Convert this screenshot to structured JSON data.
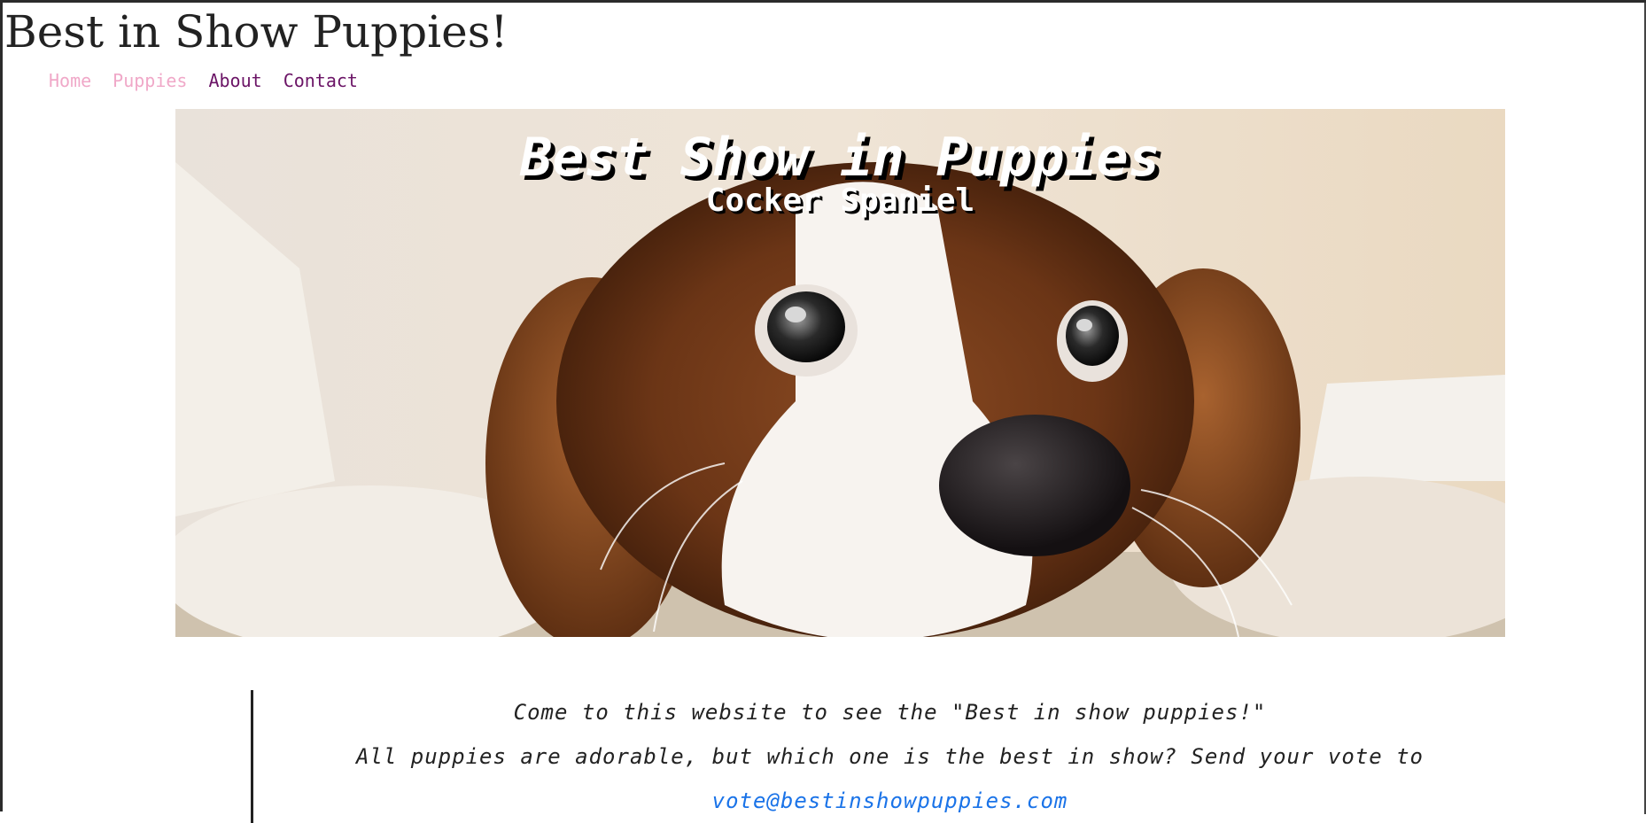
{
  "header": {
    "site_title": "Best in Show Puppies!"
  },
  "nav": {
    "items": [
      {
        "label": "Home",
        "color": "#f0a8c8"
      },
      {
        "label": "Puppies",
        "color": "#f0a8c8"
      },
      {
        "label": "About",
        "color": "#6b1466"
      },
      {
        "label": "Contact",
        "color": "#6b1466"
      }
    ]
  },
  "hero": {
    "title": "Best Show in Puppies",
    "subtitle": "Cocker Spaniel"
  },
  "intro": {
    "line1": "Come to this website to see the \"Best in show puppies!\"",
    "line2": "All puppies are adorable, but which one is the best in show? Send your vote to",
    "email": "vote@bestinshowpuppies.com"
  },
  "colors": {
    "link": "#1a73e8",
    "text": "#222222"
  }
}
